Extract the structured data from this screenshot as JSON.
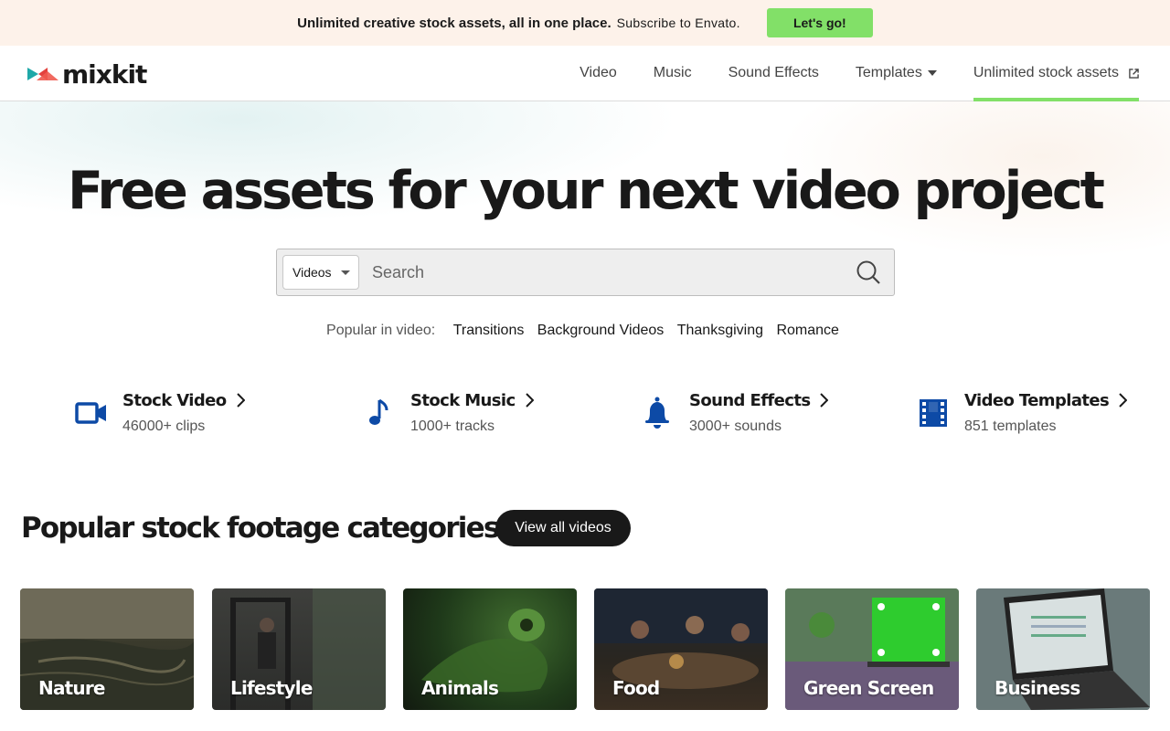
{
  "promo": {
    "headline": "Unlimited creative stock assets, all in one place.",
    "sub": "Subscribe to Envato.",
    "cta": "Let's go!"
  },
  "header": {
    "logo_text": "mixkit",
    "nav": [
      {
        "label": "Video"
      },
      {
        "label": "Music"
      },
      {
        "label": "Sound Effects"
      },
      {
        "label": "Templates"
      },
      {
        "label": "Unlimited stock assets"
      }
    ]
  },
  "hero": {
    "title": "Free assets for your next video project",
    "search": {
      "selected_type": "Videos",
      "placeholder": "Search"
    },
    "popular_label": "Popular in video:",
    "popular_links": [
      "Transitions",
      "Background Videos",
      "Thanksgiving",
      "Romance"
    ]
  },
  "stats": [
    {
      "title": "Stock Video",
      "sub": "46000+ clips",
      "icon": "video-camera-icon"
    },
    {
      "title": "Stock Music",
      "sub": "1000+ tracks",
      "icon": "music-note-icon"
    },
    {
      "title": "Sound Effects",
      "sub": "3000+ sounds",
      "icon": "bell-icon"
    },
    {
      "title": "Video Templates",
      "sub": "851 templates",
      "icon": "film-strip-icon"
    }
  ],
  "categories": {
    "title": "Popular stock footage categories",
    "view_all": "View all videos",
    "items": [
      {
        "label": "Nature"
      },
      {
        "label": "Lifestyle"
      },
      {
        "label": "Animals"
      },
      {
        "label": "Food"
      },
      {
        "label": "Green Screen"
      },
      {
        "label": "Business"
      }
    ]
  },
  "colors": {
    "accent_green": "#82e068",
    "icon_blue": "#0d4aa6",
    "promo_bg": "#fdf2ea",
    "dark": "#191919"
  }
}
